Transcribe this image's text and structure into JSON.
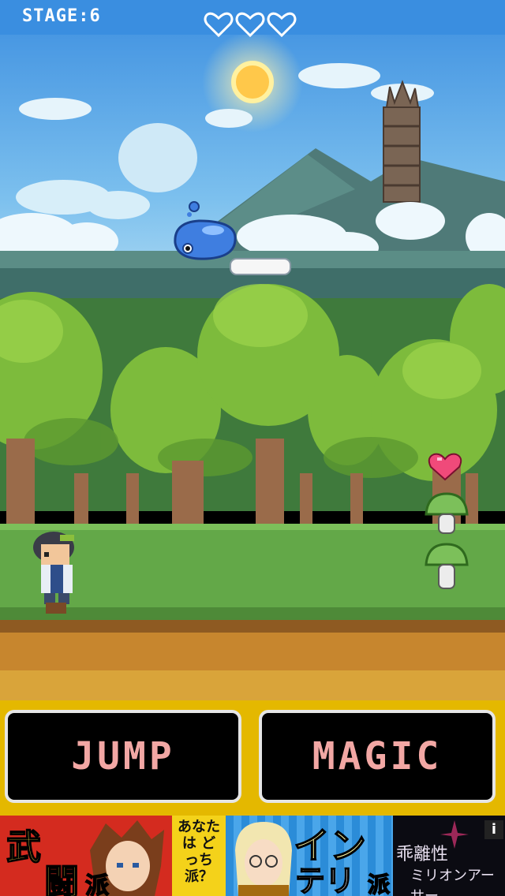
{
  "hud": {
    "stage_label": "STAGE:6",
    "lives": 3
  },
  "controls": {
    "jump_label": "JUMP",
    "magic_label": "MAGIC"
  },
  "ad": {
    "left_kanji_1": "武",
    "left_kanji_2": "闘",
    "left_suffix": "派",
    "question": "あなたは どっち派？",
    "right_text_1": "イン",
    "right_text_2": "テリ",
    "right_suffix": "派",
    "brand_line_1": "乖離性",
    "brand_line_2": "ミリオンアーサー",
    "info_label": "i"
  },
  "colors": {
    "sky": "#4aa0e8",
    "button_text": "#f2a7a4",
    "button_border": "#e6e6e6",
    "control_bar": "#e4b800"
  }
}
